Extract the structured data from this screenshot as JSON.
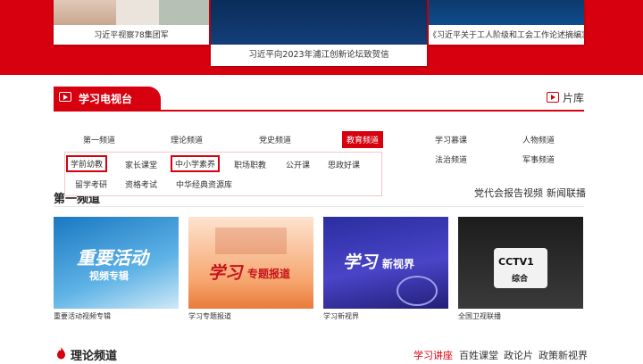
{
  "top_cards": [
    {
      "caption": "习近平视察78集团军"
    },
    {
      "caption": "习近平向2023年浦江创新论坛致贺信"
    },
    {
      "caption": "《习近平关于工人阶级和工会工作论述摘编》..."
    }
  ],
  "tv": {
    "title": "学习电视台",
    "library": "片库"
  },
  "channels": [
    "第一频道",
    "理论频道",
    "党史频道",
    "教育频道"
  ],
  "channels_right": [
    "学习慕课",
    "人物频道",
    "法治频道",
    "军事频道"
  ],
  "sub_channels_row1": [
    "学前幼教",
    "家长课堂",
    "中小学素养",
    "职场职教",
    "公开课",
    "思政好课"
  ],
  "sub_channels_row2": [
    "留学考研",
    "资格考试",
    "中华经典资源库"
  ],
  "section_links": [
    "党代会报告视频",
    "新闻联播"
  ],
  "videos": [
    {
      "caption": "重要活动视频专辑",
      "title": "重要活动",
      "subtitle": "视频专辑"
    },
    {
      "caption": "学习专题报道",
      "title": "学习",
      "subtitle": "专题报道"
    },
    {
      "caption": "学习新视界",
      "title": "学习",
      "subtitle": "新视界"
    },
    {
      "caption": "全国卫视联播",
      "title": "CCTV1",
      "subtitle": "综合"
    }
  ],
  "theory": {
    "title": "理论频道",
    "links": [
      "学习讲座",
      "百姓课堂",
      "政论片",
      "政策新视界"
    ]
  },
  "colors": {
    "brand_red": "#d7000f"
  }
}
